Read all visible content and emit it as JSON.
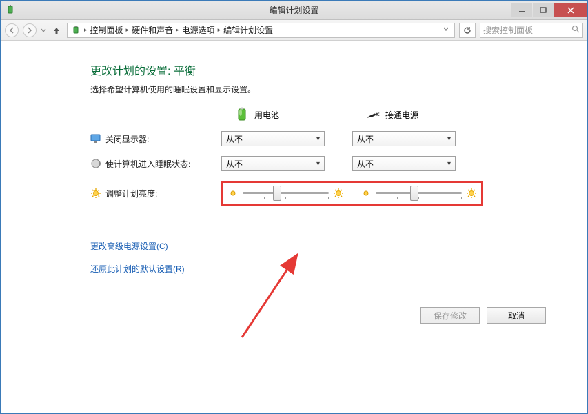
{
  "titlebar": {
    "title": "编辑计划设置"
  },
  "breadcrumb": {
    "items": [
      "控制面板",
      "硬件和声音",
      "电源选项",
      "编辑计划设置"
    ]
  },
  "search": {
    "placeholder": "搜索控制面板"
  },
  "page": {
    "heading": "更改计划的设置: 平衡",
    "subtext": "选择希望计算机使用的睡眠设置和显示设置。"
  },
  "columns": {
    "battery": "用电池",
    "plugged": "接通电源"
  },
  "rows": {
    "display_off": {
      "label": "关闭显示器:",
      "battery_value": "从不",
      "plugged_value": "从不"
    },
    "sleep": {
      "label": "使计算机进入睡眠状态:",
      "battery_value": "从不",
      "plugged_value": "从不"
    },
    "brightness": {
      "label": "调整计划亮度:",
      "battery_pct": 40,
      "plugged_pct": 45
    }
  },
  "links": {
    "advanced": "更改高级电源设置(C)",
    "restore": "还原此计划的默认设置(R)"
  },
  "buttons": {
    "save": "保存修改",
    "cancel": "取消"
  }
}
